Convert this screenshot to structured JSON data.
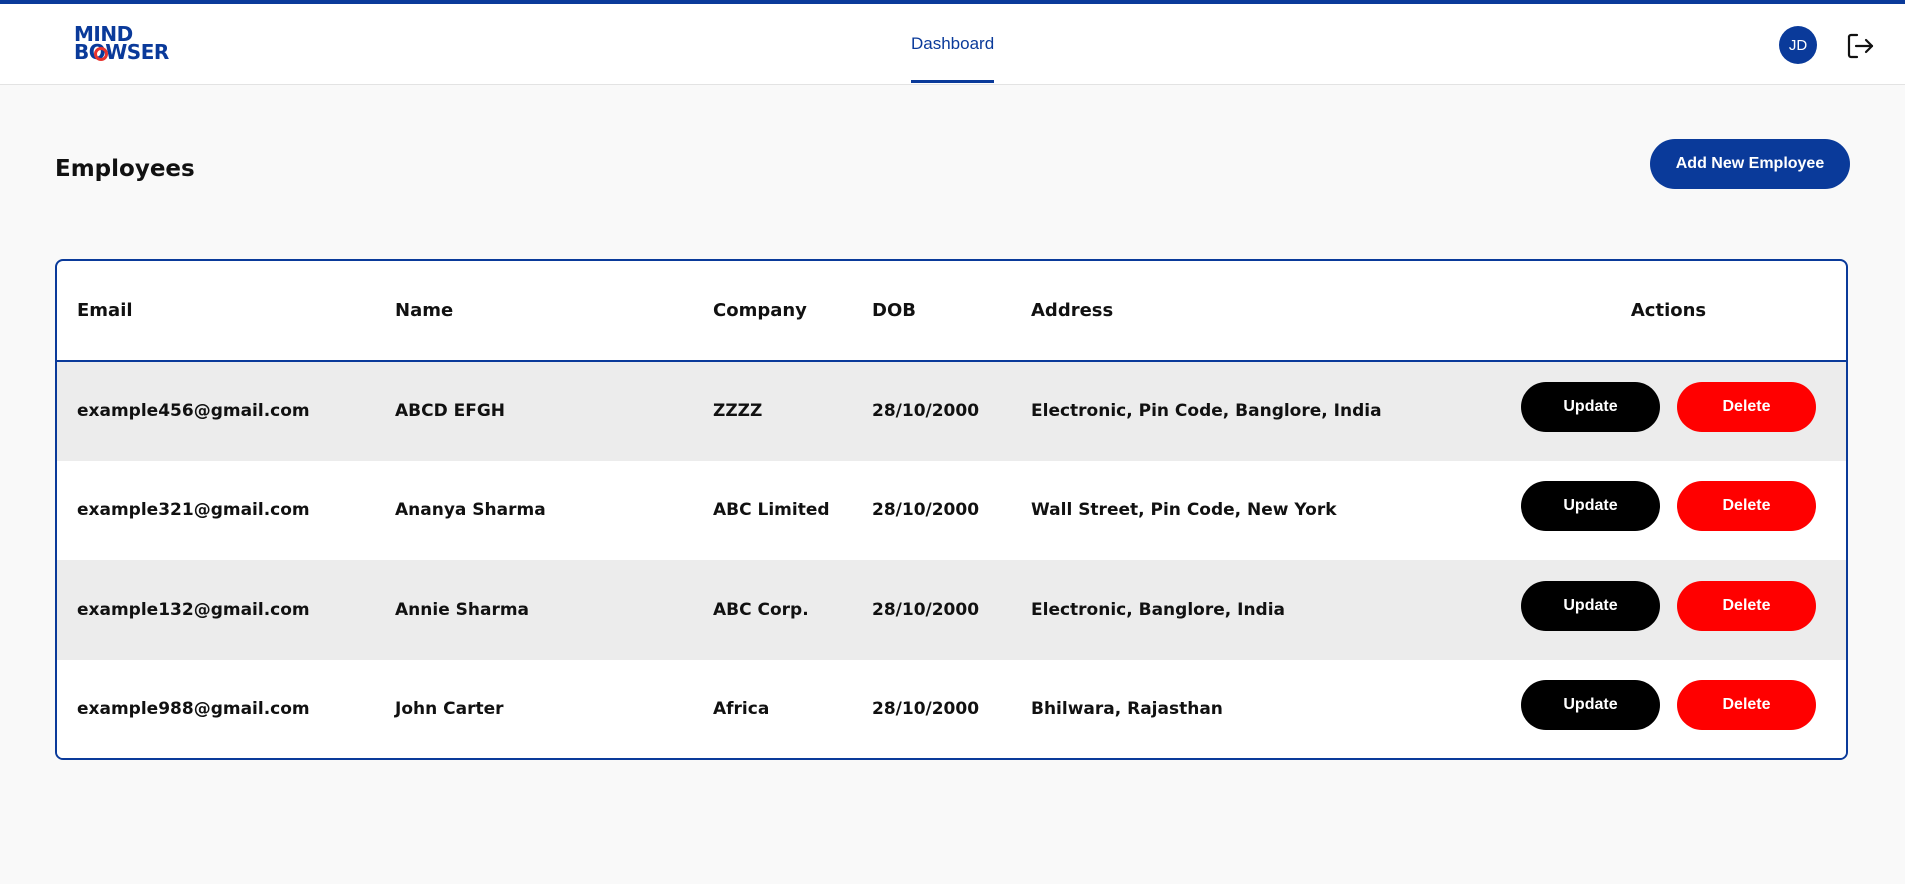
{
  "colors": {
    "brand": "#0a3a9a",
    "delete": "#ff0000",
    "update": "#000000"
  },
  "header": {
    "logo_line1": "MIND",
    "logo_line2": "BOWSER",
    "nav_tab": "Dashboard",
    "avatar_initials": "JD",
    "logout_icon": "logout-icon"
  },
  "page": {
    "title": "Employees",
    "add_button": "Add New Employee"
  },
  "table": {
    "columns": [
      "Email",
      "Name",
      "Company",
      "DOB",
      "Address",
      "Actions"
    ],
    "update_label": "Update",
    "delete_label": "Delete",
    "rows": [
      {
        "email": "example456@gmail.com",
        "name": "ABCD EFGH",
        "company": "ZZZZ",
        "dob": "28/10/2000",
        "address": "Electronic, Pin Code, Banglore, India"
      },
      {
        "email": "example321@gmail.com",
        "name": "Ananya Sharma",
        "company": "ABC Limited",
        "dob": "28/10/2000",
        "address": "Wall Street, Pin Code, New York"
      },
      {
        "email": "example132@gmail.com",
        "name": "Annie Sharma",
        "company": "ABC Corp.",
        "dob": "28/10/2000",
        "address": "Electronic, Banglore, India"
      },
      {
        "email": "example988@gmail.com",
        "name": "John Carter",
        "company": "Africa",
        "dob": "28/10/2000",
        "address": "Bhilwara, Rajasthan"
      }
    ]
  }
}
